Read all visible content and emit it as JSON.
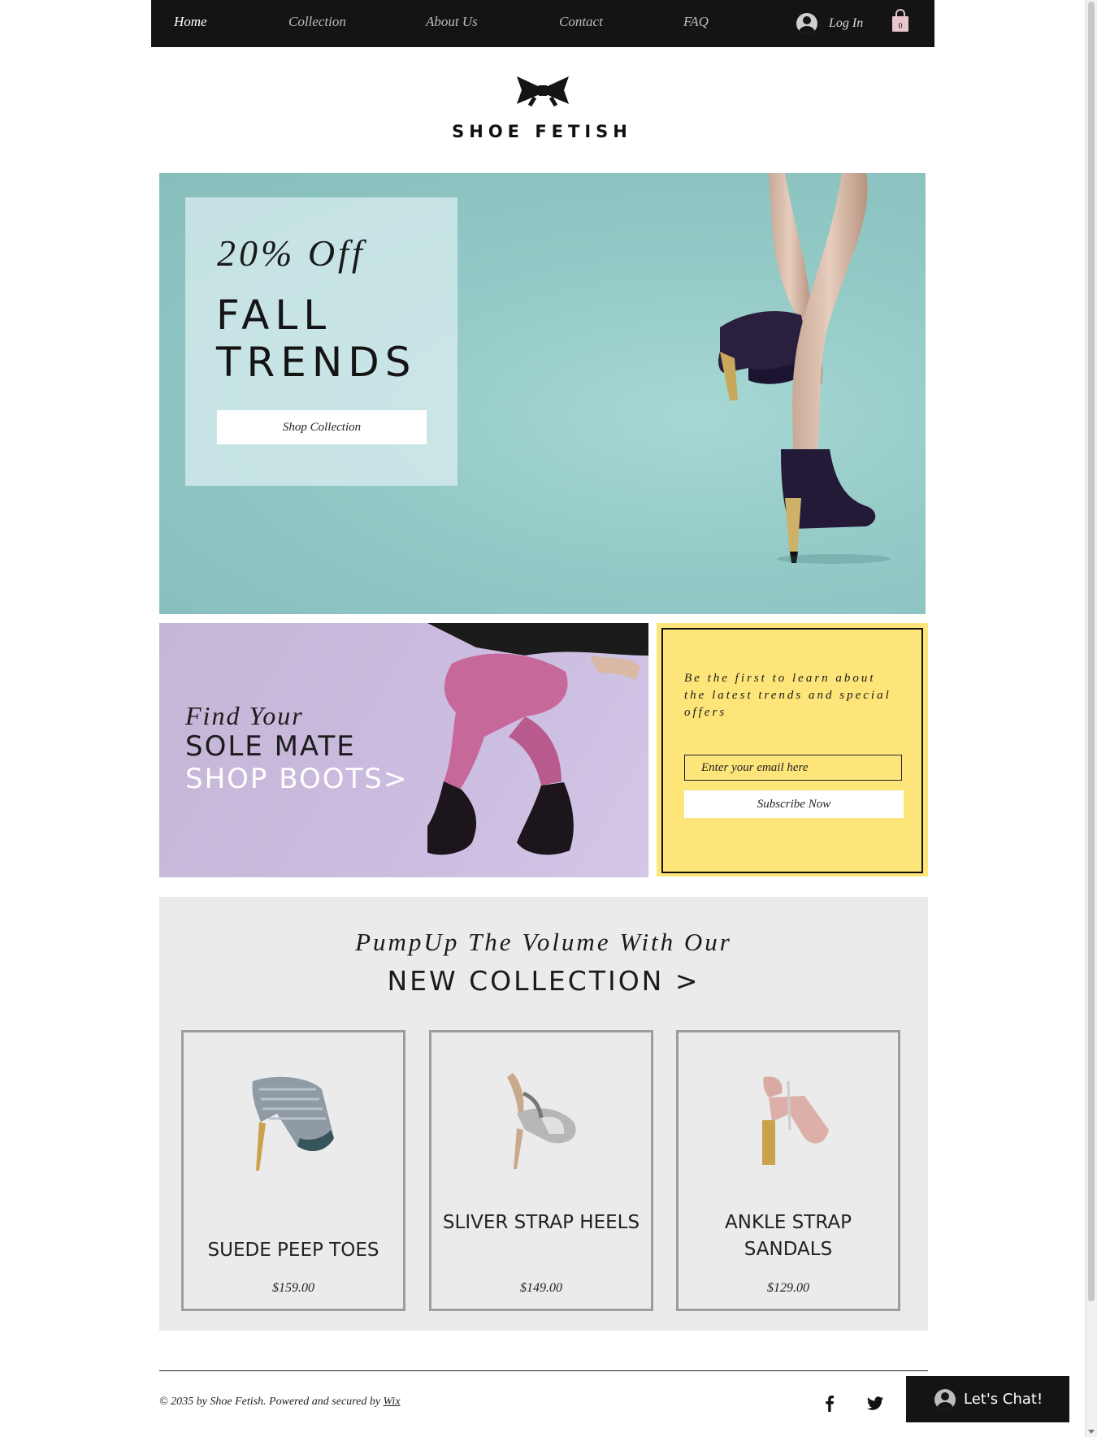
{
  "nav": {
    "items": [
      "Home",
      "Collection",
      "About Us",
      "Contact",
      "FAQ"
    ],
    "active": "Home",
    "login_label": "Log In",
    "cart_count": "0"
  },
  "brand": {
    "name": "SHOE FETISH",
    "logo_icon": "bow-icon"
  },
  "hero": {
    "discount": "20% Off",
    "title_line1": "FALL",
    "title_line2": "TRENDS",
    "cta_label": "Shop Collection",
    "bg_color": "#93c9c6"
  },
  "boots_promo": {
    "line1": "Find Your",
    "line2": "SOLE MATE",
    "line3": "SHOP BOOTS>",
    "bg_color": "#c8b8da"
  },
  "newsletter": {
    "text": "Be the first to learn about the latest trends and special offers",
    "email_placeholder": "Enter your email here",
    "button_label": "Subscribe Now",
    "bg_color": "#fde57a"
  },
  "collection": {
    "kicker": "PumpUp The Volume With Our",
    "title": "NEW COLLECTION >",
    "products": [
      {
        "name": "SUEDE PEEP TOES",
        "price": "$159.00"
      },
      {
        "name": "SLIVER STRAP HEELS",
        "price": "$149.00"
      },
      {
        "name": "ANKLE STRAP SANDALS",
        "price": "$129.00"
      }
    ]
  },
  "footer": {
    "copyright": "© 2035 by Shoe Fetish. Powered and secured by ",
    "link_label": "Wix",
    "social": [
      "facebook-icon",
      "twitter-icon"
    ]
  },
  "chat": {
    "label": "Let's Chat!"
  }
}
